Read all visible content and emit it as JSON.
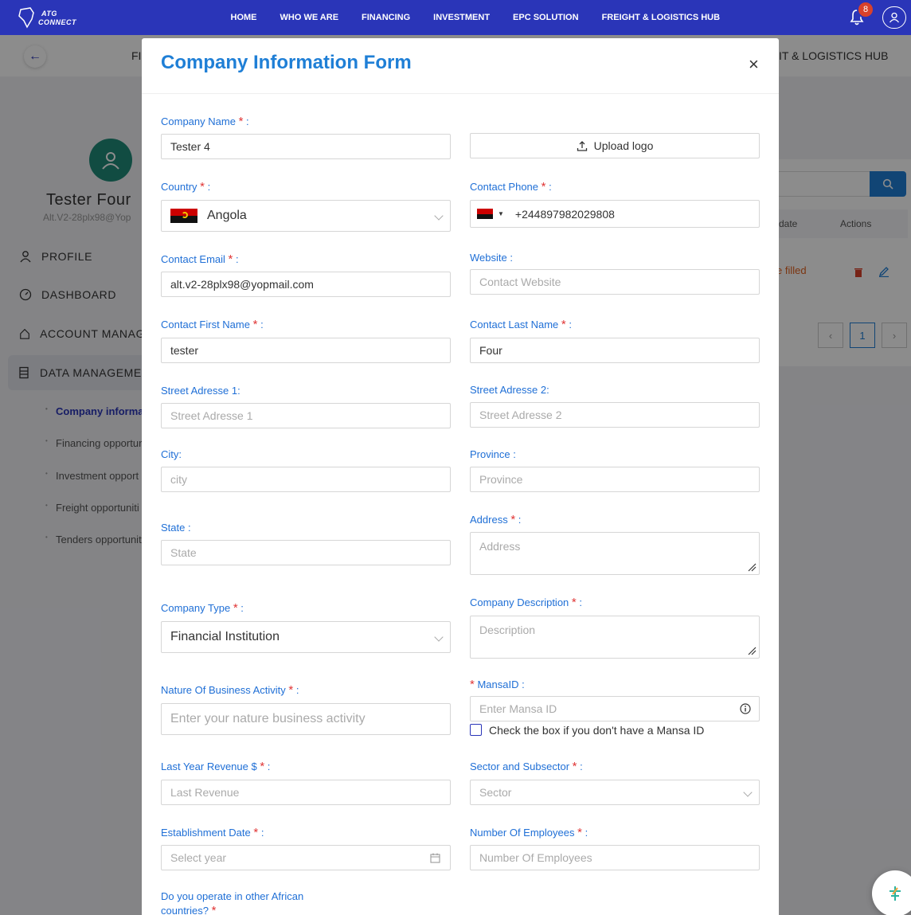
{
  "nav": {
    "logo_line1": "ATG",
    "logo_line2": "CONNECT",
    "links": [
      "HOME",
      "WHO WE ARE",
      "FINANCING",
      "INVESTMENT",
      "EPC SOLUTION",
      "FREIGHT & LOGISTICS HUB"
    ],
    "notification_count": "8"
  },
  "subbar": {
    "left_fragment": "FI",
    "right_fragment": "IT & LOGISTICS HUB"
  },
  "profile": {
    "name": "Tester Four",
    "email": "Alt.V2-28plx98@Yop"
  },
  "sidebar": {
    "items": [
      {
        "label": "PROFILE",
        "icon": "user-icon"
      },
      {
        "label": "DASHBOARD",
        "icon": "dashboard-icon"
      },
      {
        "label": "ACCOUNT MANAGE",
        "icon": "home-icon"
      },
      {
        "label": "DATA MANAGEMEN",
        "icon": "database-icon"
      }
    ],
    "subitems": [
      "Company informa",
      "Financing opportur",
      "Investment opport",
      "Freight opportuniti",
      "Tenders opportunit"
    ]
  },
  "table": {
    "col_date": "date",
    "col_actions": "Actions",
    "row_status": "e filled",
    "page_current": "1"
  },
  "modal": {
    "title": "Company Information Form",
    "close": "×",
    "fields": {
      "company_name": {
        "label": "Company Name",
        "value": "Tester 4"
      },
      "upload_logo": {
        "label": "Upload logo"
      },
      "country": {
        "label": "Country",
        "value": "Angola"
      },
      "contact_phone": {
        "label": "Contact Phone",
        "value": "+244897982029808"
      },
      "contact_email": {
        "label": "Contact Email",
        "value": "alt.v2-28plx98@yopmail.com"
      },
      "website": {
        "label": "Website",
        "placeholder": "Contact Website"
      },
      "first_name": {
        "label": "Contact First Name",
        "value": "tester"
      },
      "last_name": {
        "label": "Contact Last Name",
        "value": "Four"
      },
      "street1": {
        "label": "Street Adresse 1",
        "placeholder": "Street Adresse 1"
      },
      "street2": {
        "label": "Street Adresse 2",
        "placeholder": "Street Adresse 2"
      },
      "city": {
        "label": "City",
        "placeholder": "city"
      },
      "province": {
        "label": "Province",
        "placeholder": "Province"
      },
      "state": {
        "label": "State",
        "placeholder": "State"
      },
      "address": {
        "label": "Address",
        "placeholder": "Address"
      },
      "company_type": {
        "label": "Company Type",
        "value": "Financial Institution"
      },
      "company_description": {
        "label": "Company Description",
        "placeholder": "Description"
      },
      "nature_of_business": {
        "label": "Nature Of Business Activity",
        "placeholder": "Enter your nature business activity"
      },
      "mansa_id": {
        "label": "MansaID",
        "placeholder": "Enter Mansa ID",
        "checkbox_label": "Check the box if you don't have a Mansa ID"
      },
      "last_year_revenue": {
        "label": "Last Year Revenue $",
        "placeholder": "Last Revenue"
      },
      "sector": {
        "label": "Sector and Subsector",
        "placeholder": "Sector"
      },
      "establishment_date": {
        "label": "Establishment Date",
        "placeholder": "Select year"
      },
      "employees": {
        "label": "Number Of Employees",
        "placeholder": "Number Of Employees"
      },
      "operate_africa": {
        "label_line1": "Do you operate in other African",
        "label_line2": "countries?"
      }
    }
  },
  "colors": {
    "nav_bg": "#2a35b8",
    "accent": "#1f7fd6",
    "required": "#e03535",
    "avatar": "#1f8a78"
  }
}
